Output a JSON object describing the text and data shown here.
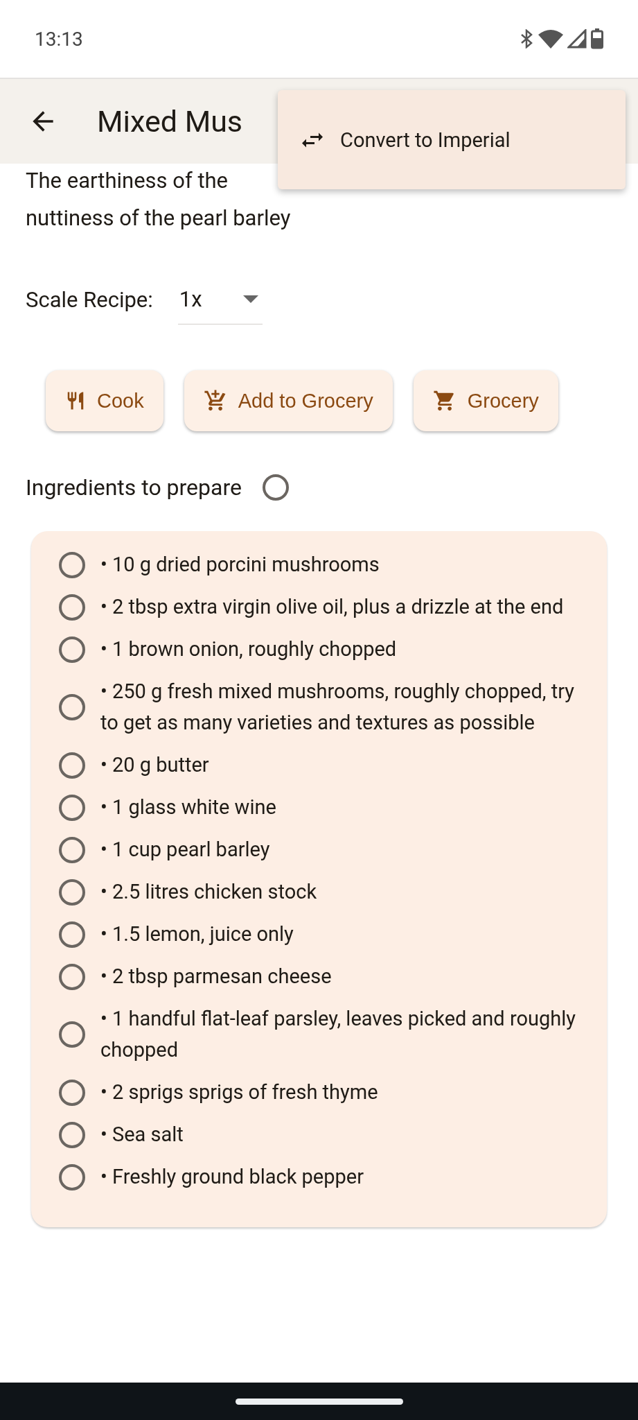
{
  "status_bar": {
    "time": "13:13"
  },
  "app_bar": {
    "title": "Mixed Mus"
  },
  "menu": {
    "items": [
      {
        "label": "Convert to Imperial"
      }
    ]
  },
  "description": [
    "The earthiness of the",
    "nuttiness of the pearl barley"
  ],
  "scale": {
    "label": "Scale Recipe:",
    "value": "1x"
  },
  "buttons": [
    {
      "kind": "cook",
      "label": "Cook"
    },
    {
      "kind": "add-grocery",
      "label": "Add to Grocery"
    },
    {
      "kind": "grocery",
      "label": "Grocery"
    }
  ],
  "ingredients": {
    "heading": "Ingredients to prepare",
    "all_checked": false,
    "items": [
      {
        "text": "• 10 g dried porcini mushrooms",
        "checked": false
      },
      {
        "text": "• 2 tbsp extra virgin olive oil, plus a drizzle at the end",
        "checked": false
      },
      {
        "text": "• 1 brown onion, roughly chopped",
        "checked": false
      },
      {
        "text": "• 250 g fresh mixed mushrooms, roughly chopped, try to get as many varieties and textures as possible",
        "checked": false
      },
      {
        "text": "• 20 g butter",
        "checked": false
      },
      {
        "text": "• 1 glass white wine",
        "checked": false
      },
      {
        "text": "• 1 cup pearl barley",
        "checked": false
      },
      {
        "text": "• 2.5 litres chicken stock",
        "checked": false
      },
      {
        "text": "• 1.5 lemon, juice only",
        "checked": false
      },
      {
        "text": "• 2 tbsp parmesan cheese",
        "checked": false
      },
      {
        "text": "• 1 handful flat-leaf parsley, leaves picked and roughly chopped",
        "checked": false
      },
      {
        "text": "• 2 sprigs sprigs of fresh thyme",
        "checked": false
      },
      {
        "text": "• Sea salt",
        "checked": false
      },
      {
        "text": "• Freshly ground black pepper",
        "checked": false
      }
    ]
  }
}
